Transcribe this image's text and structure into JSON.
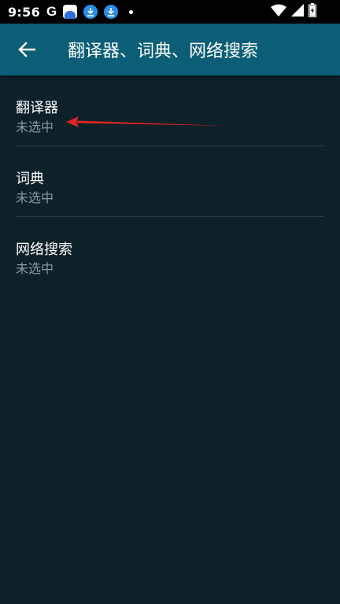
{
  "status_bar": {
    "time": "9:56",
    "left_icons": [
      "google-g-icon",
      "app-notification-icon",
      "download-icon",
      "download-icon",
      "more-dot-icon"
    ],
    "right_icons": [
      "wifi-icon",
      "cell-signal-icon",
      "battery-icon"
    ],
    "google_letter": "G"
  },
  "app_bar": {
    "title": "翻译器、词典、网络搜索",
    "back_icon": "arrow-left-icon",
    "color": "#0b5e76"
  },
  "list": {
    "items": [
      {
        "title": "翻译器",
        "summary": "未选中"
      },
      {
        "title": "词典",
        "summary": "未选中"
      },
      {
        "title": "网络搜索",
        "summary": "未选中"
      }
    ]
  },
  "annotation": {
    "arrow_color": "#e02424",
    "arrow_icon": "red-pointer-arrow"
  }
}
